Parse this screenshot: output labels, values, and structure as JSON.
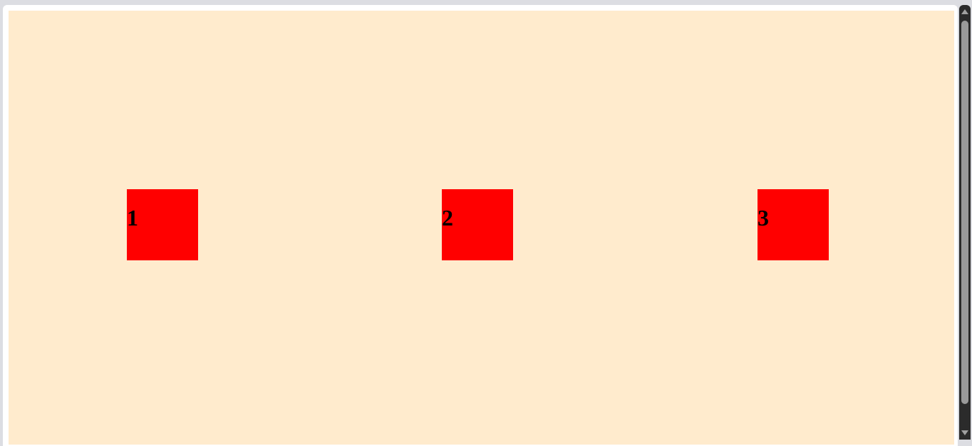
{
  "boxes": [
    {
      "label": "1"
    },
    {
      "label": "2"
    },
    {
      "label": "3"
    }
  ],
  "colors": {
    "canvas_background": "#ffebcd",
    "box_fill": "#ff0000",
    "label_text": "#000000"
  },
  "scrollbar": {
    "thumb_fraction": 0.95,
    "scroll_position": 0
  }
}
